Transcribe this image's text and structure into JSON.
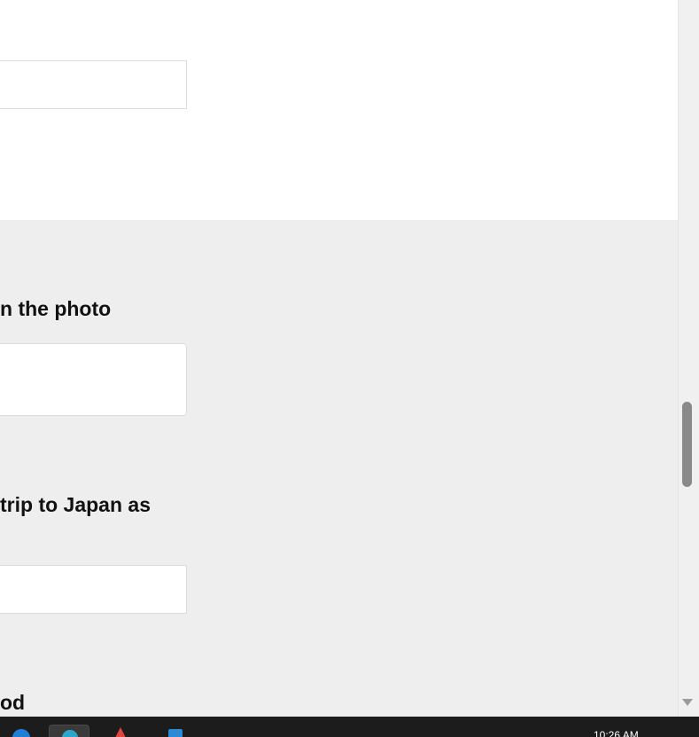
{
  "form": {
    "fields": [
      {
        "label": "",
        "value": ""
      },
      {
        "label": "n the photo",
        "value": ""
      },
      {
        "label": "trip to Japan as",
        "value": ""
      },
      {
        "label": "od",
        "value": ""
      }
    ]
  },
  "colors": {
    "section_white": "#ffffff",
    "section_gray": "#eeeeee",
    "input_border": "#dcdcdc",
    "scroll_thumb": "#8a8a8a",
    "taskbar": "#1c1c1c"
  },
  "taskbar": {
    "clock": "10:26 AM",
    "icons": [
      "edge-icon",
      "active-app-icon",
      "app-icon",
      "store-icon"
    ]
  }
}
